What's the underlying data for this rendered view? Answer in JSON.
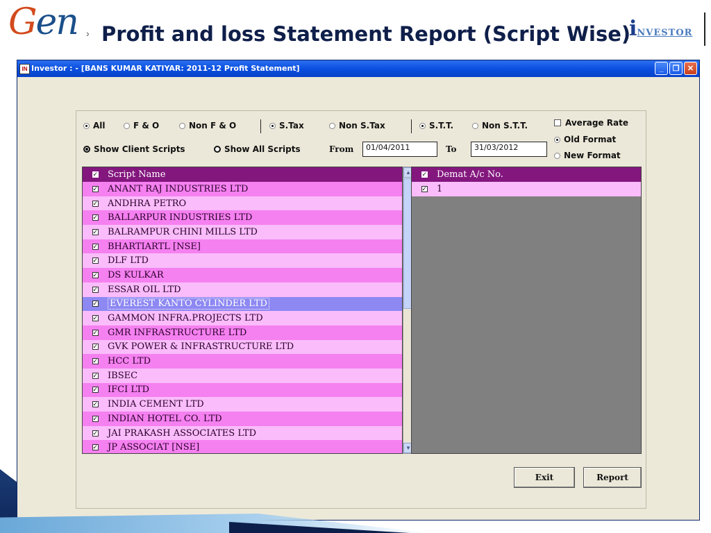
{
  "slide": {
    "logo_g": "G",
    "logo_rest": "en",
    "bullet": "›",
    "title": "Profit and loss Statement Report (Script Wise)",
    "investor_logo_i": "i",
    "investor_logo_rest": "NVESTOR"
  },
  "window": {
    "title": "Investor : - [BANS KUMAR KATIYAR: 2011-12 Profit Statement]",
    "min": "_",
    "max": "❐",
    "close": "✕"
  },
  "filters": {
    "all": "All",
    "fo": "F & O",
    "non_fo": "Non F & O",
    "stax": "S.Tax",
    "non_stax": "Non S.Tax",
    "stt": "S.T.T.",
    "non_stt": "Non S.T.T.",
    "average_rate": "Average Rate",
    "old_format": "Old Format",
    "new_format": "New Format",
    "show_client_scripts": "Show Client Scripts",
    "show_all_scripts": "Show All Scripts",
    "from_label": "From",
    "from_value": "01/04/2011",
    "to_label": "To",
    "to_value": "31/03/2012"
  },
  "scripts": {
    "header": "Script Name",
    "rows": [
      "ANANT RAJ INDUSTRIES LTD",
      "ANDHRA PETRO",
      "BALLARPUR INDUSTRIES LTD",
      "BALRAMPUR CHINI MILLS LTD",
      "BHARTIARTL [NSE]",
      "DLF LTD",
      "DS KULKAR",
      "ESSAR OIL LTD",
      "EVEREST KANTO CYLINDER LTD",
      "GAMMON INFRA.PROJECTS LTD",
      "GMR INFRASTRUCTURE LTD",
      "GVK POWER & INFRASTRUCTURE LTD",
      "HCC LTD",
      "IBSEC",
      "IFCI LTD",
      "INDIA CEMENT LTD",
      "INDIAN HOTEL CO. LTD",
      "JAI PRAKASH  ASSOCIATES LTD",
      "JP ASSOCIAT [NSE]"
    ],
    "selected_index": 8
  },
  "demat": {
    "header": "Demat A/c No.",
    "rows": [
      "1"
    ]
  },
  "buttons": {
    "exit": "Exit",
    "report": "Report"
  },
  "colors": {
    "grid_header": "#83177e",
    "row_dark": "#f580f0",
    "row_light": "#fabcfb",
    "row_selected": "#8d88f2",
    "titlebar": "#0a4fe0"
  }
}
